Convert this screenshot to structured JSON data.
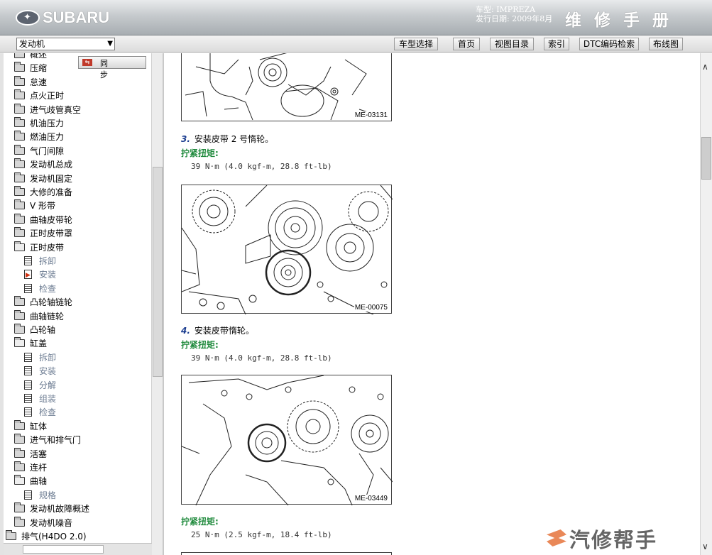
{
  "header": {
    "brand": "SUBARU",
    "model_line": "车型: IMPREZA",
    "date_line": "发行日期: 2009年8月",
    "title": "维修手册"
  },
  "toolbar": {
    "section_select_value": "发动机",
    "buttons": [
      "车型选择",
      "首页",
      "视图目录",
      "索引",
      "DTC编码检索",
      "布线图"
    ]
  },
  "sidebar": {
    "sync_label": "同步",
    "items": [
      {
        "label": "概述",
        "kind": "folder"
      },
      {
        "label": "压缩",
        "kind": "folder"
      },
      {
        "label": "怠速",
        "kind": "folder"
      },
      {
        "label": "点火正时",
        "kind": "folder"
      },
      {
        "label": "进气歧管真空",
        "kind": "folder"
      },
      {
        "label": "机油压力",
        "kind": "folder"
      },
      {
        "label": "燃油压力",
        "kind": "folder"
      },
      {
        "label": "气门间隙",
        "kind": "folder"
      },
      {
        "label": "发动机总成",
        "kind": "folder"
      },
      {
        "label": "发动机固定",
        "kind": "folder"
      },
      {
        "label": "大修的准备",
        "kind": "folder"
      },
      {
        "label": "V 形带",
        "kind": "folder"
      },
      {
        "label": "曲轴皮带轮",
        "kind": "folder"
      },
      {
        "label": "正时皮带罩",
        "kind": "folder"
      },
      {
        "label": "正时皮带",
        "kind": "folder-open"
      },
      {
        "label": "拆卸",
        "kind": "doc"
      },
      {
        "label": "安装",
        "kind": "doc-active"
      },
      {
        "label": "检查",
        "kind": "doc"
      },
      {
        "label": "凸轮轴链轮",
        "kind": "folder"
      },
      {
        "label": "曲轴链轮",
        "kind": "folder"
      },
      {
        "label": "凸轮轴",
        "kind": "folder"
      },
      {
        "label": "缸盖",
        "kind": "folder-open"
      },
      {
        "label": "拆卸",
        "kind": "doc"
      },
      {
        "label": "安装",
        "kind": "doc"
      },
      {
        "label": "分解",
        "kind": "doc"
      },
      {
        "label": "组装",
        "kind": "doc"
      },
      {
        "label": "检查",
        "kind": "doc"
      },
      {
        "label": "缸体",
        "kind": "folder"
      },
      {
        "label": "进气和排气门",
        "kind": "folder"
      },
      {
        "label": "活塞",
        "kind": "folder"
      },
      {
        "label": "连杆",
        "kind": "folder"
      },
      {
        "label": "曲轴",
        "kind": "folder-open"
      },
      {
        "label": "规格",
        "kind": "doc"
      },
      {
        "label": "发动机故障概述",
        "kind": "folder"
      },
      {
        "label": "发动机噪音",
        "kind": "folder"
      },
      {
        "label": "排气(H4DO 2.0)",
        "kind": "folder-root"
      }
    ]
  },
  "content": {
    "figures": [
      "ME-03131",
      "ME-00075",
      "ME-03449"
    ],
    "steps": [
      {
        "num": "3.",
        "text": "安装皮带 2 号惰轮。",
        "torque_label": "拧紧扭矩:",
        "torque_value": "39 N·m (4.0 kgf-m, 28.8 ft-lb)"
      },
      {
        "num": "4.",
        "text": "安装皮带惰轮。",
        "torque_label": "拧紧扭矩:",
        "torque_value": "39 N·m (4.0 kgf-m, 28.8 ft-lb)"
      },
      {
        "num": "",
        "text": "",
        "torque_label": "拧紧扭矩:",
        "torque_value": "25 N·m (2.5 kgf-m, 18.4 ft-lb)"
      }
    ]
  },
  "watermark": "汽修帮手"
}
